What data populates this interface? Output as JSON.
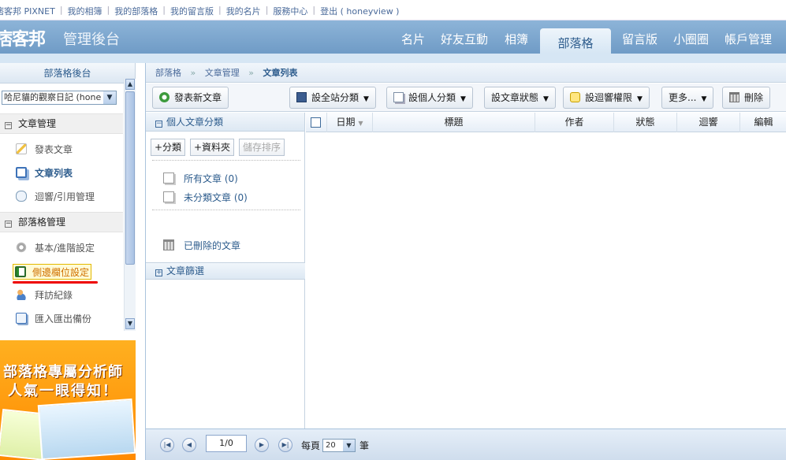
{
  "topnav": {
    "links": [
      "痞客邦 PIXNET",
      "我的相簿",
      "我的部落格",
      "我的留言版",
      "我的名片",
      "服務中心",
      "登出 ( honeyview )"
    ],
    "separator": "|"
  },
  "header": {
    "logo": "痞客邦",
    "subtitle": "管理後台",
    "tabs": [
      "名片",
      "好友互動",
      "相簿",
      "部落格",
      "留言版",
      "小圈圈",
      "帳戶管理"
    ],
    "active_tab": "部落格"
  },
  "sidebar": {
    "title": "部落格後台",
    "blog_select": "哈尼貓的觀察日記 (hone",
    "sections": [
      {
        "label": "文章管理",
        "items": [
          "發表文章",
          "文章列表",
          "迴響/引用管理"
        ]
      },
      {
        "label": "部落格管理",
        "items": [
          "基本/進階設定",
          "側邊欄位設定",
          "拜訪紀錄",
          "匯入匯出備份"
        ]
      }
    ],
    "ad": {
      "line1": "部落格專屬分析師",
      "line2": "人氣一眼得知！"
    }
  },
  "breadcrumb": {
    "items": [
      "部落格",
      "文章管理"
    ],
    "current": "文章列表",
    "separator": "»"
  },
  "toolbar": {
    "new_post": "發表新文章",
    "site_category": "設全站分類",
    "personal_category": "設個人分類",
    "post_status": "設文章狀態",
    "comment_permission": "設迴響權限",
    "more": "更多...",
    "delete": "刪除"
  },
  "category_pane": {
    "title": "個人文章分類",
    "add_category": "+分類",
    "add_folder": "+資料夾",
    "save_order": "儲存排序",
    "all_posts": "所有文章 (0)",
    "uncategorized": "未分類文章 (0)",
    "deleted": "已刪除的文章",
    "filter": "文章篩選"
  },
  "grid": {
    "columns": [
      "日期",
      "標題",
      "作者",
      "狀態",
      "迴響",
      "編輯"
    ]
  },
  "pager": {
    "page_value": "1/0",
    "per_page_label": "每頁",
    "per_page_value": "20",
    "unit": "筆"
  },
  "colors": {
    "header_blue": "#7aa5cf",
    "highlight_orange": "#d07000",
    "ad_orange": "#ff9c10",
    "underline_red": "#e00000"
  }
}
